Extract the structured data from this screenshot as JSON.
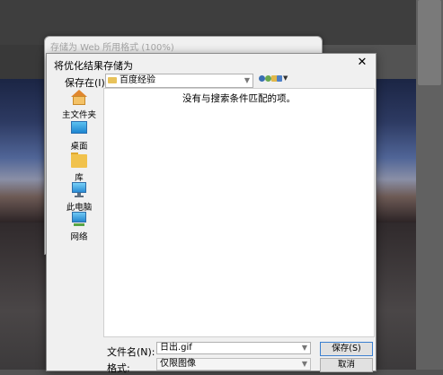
{
  "back_window": {
    "title": "存储为 Web 所用格式 (100%)"
  },
  "dialog": {
    "title": "将优化结果存储为",
    "close_label": "✕",
    "save_in_label": "保存在(I):",
    "save_in_value": "百度经验",
    "empty_message": "没有与搜索条件匹配的项。",
    "places": [
      {
        "label": "主文件夹",
        "icon": "home-folder-icon"
      },
      {
        "label": "桌面",
        "icon": "desktop-icon"
      },
      {
        "label": "库",
        "icon": "library-folder-icon"
      },
      {
        "label": "此电脑",
        "icon": "computer-icon"
      },
      {
        "label": "网络",
        "icon": "network-icon"
      }
    ],
    "filename_label": "文件名(N):",
    "filename_value": "日出.gif",
    "format_label": "格式:",
    "format_value": "仅限图像",
    "save_button": "保存(S)",
    "cancel_button": "取消"
  }
}
